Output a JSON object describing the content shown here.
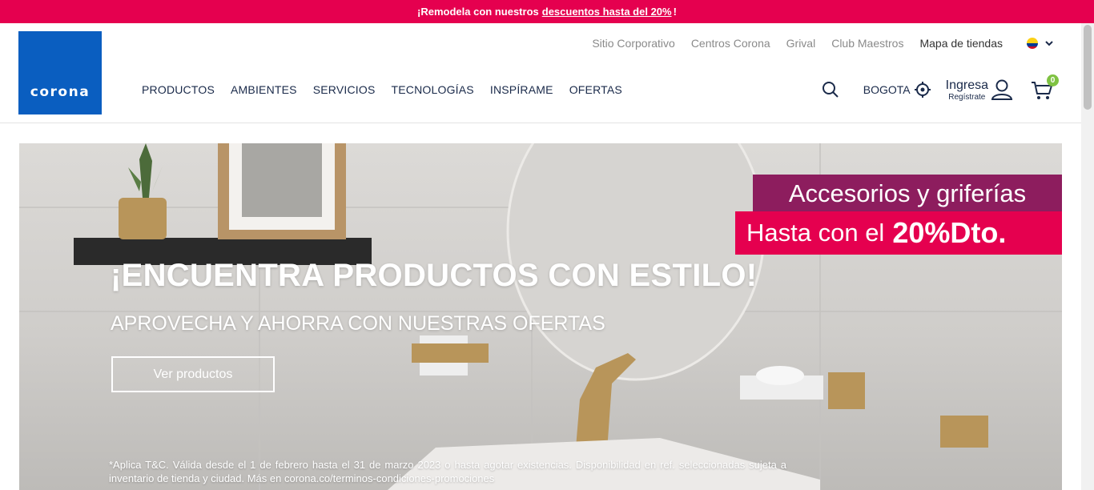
{
  "promo": {
    "text": "¡Remodela con nuestros",
    "link": "descuentos hasta del 20%",
    "tail": "!"
  },
  "logo": {
    "text": "corona"
  },
  "top_links": [
    "Sitio Corporativo",
    "Centros Corona",
    "Grival",
    "Club Maestros",
    "Mapa de tiendas"
  ],
  "country_flag": {
    "icon": "colombia-flag-icon",
    "colors": [
      "#fcd116",
      "#003893",
      "#ce1126"
    ]
  },
  "main_nav": [
    "PRODUCTOS",
    "AMBIENTES",
    "SERVICIOS",
    "TECNOLOGÍAS",
    "INSPÍRAME",
    "OFERTAS"
  ],
  "right_nav": {
    "city": "BOGOTA",
    "login": "Ingresa",
    "register": "Regístrate",
    "cart_count": "0"
  },
  "hero": {
    "title": "¡ENCUENTRA PRODUCTOS CON ESTILO!",
    "subtitle": "APROVECHA Y AHORRA CON NUESTRAS OFERTAS",
    "button": "Ver productos",
    "badge_top": "Accesorios y griferías",
    "badge_bottom": "Hasta con el",
    "badge_bottom_bold": "20%Dto.",
    "legal": "*Aplica T&C. Válida desde el 1 de febrero hasta el 31 de marzo 2023 o hasta agotar existencias. Disponibilidad en ref. seleccionadas sujeta a inventario de tienda y ciudad. Más en corona.co/terminos-condiciones-promociones"
  },
  "colors": {
    "brand_blue": "#0a5ec0",
    "promo_pink": "#e5004f",
    "badge_purple": "#8d1d5e",
    "cart_badge": "#7fc242"
  }
}
